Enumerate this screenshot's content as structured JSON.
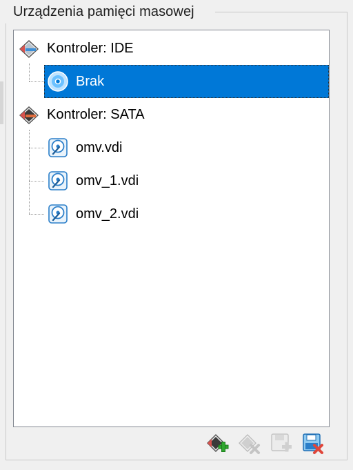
{
  "group": {
    "title": "Urządzenia pamięci masowej"
  },
  "tree": {
    "controllers": [
      {
        "label": "Kontroler: IDE",
        "icon": "ide-controller-icon",
        "children": [
          {
            "label": "Brak",
            "icon": "optical-disc-icon",
            "selected": true
          }
        ]
      },
      {
        "label": "Kontroler: SATA",
        "icon": "sata-controller-icon",
        "children": [
          {
            "label": "omv.vdi",
            "icon": "hard-disk-icon"
          },
          {
            "label": "omv_1.vdi",
            "icon": "hard-disk-icon"
          },
          {
            "label": "omv_2.vdi",
            "icon": "hard-disk-icon"
          }
        ]
      }
    ]
  },
  "toolbar": {
    "buttons": [
      {
        "name": "add-controller",
        "icon": "add-controller-icon",
        "enabled": true
      },
      {
        "name": "add-attachment",
        "icon": "add-attachment-icon",
        "enabled": false
      },
      {
        "name": "remove-attachment",
        "icon": "remove-attachment-icon",
        "enabled": false
      },
      {
        "name": "remove-controller",
        "icon": "remove-controller-icon",
        "enabled": true
      }
    ]
  },
  "colors": {
    "selection": "#0078d7",
    "background": "#f0f0f0",
    "tree_background": "#ffffff"
  }
}
